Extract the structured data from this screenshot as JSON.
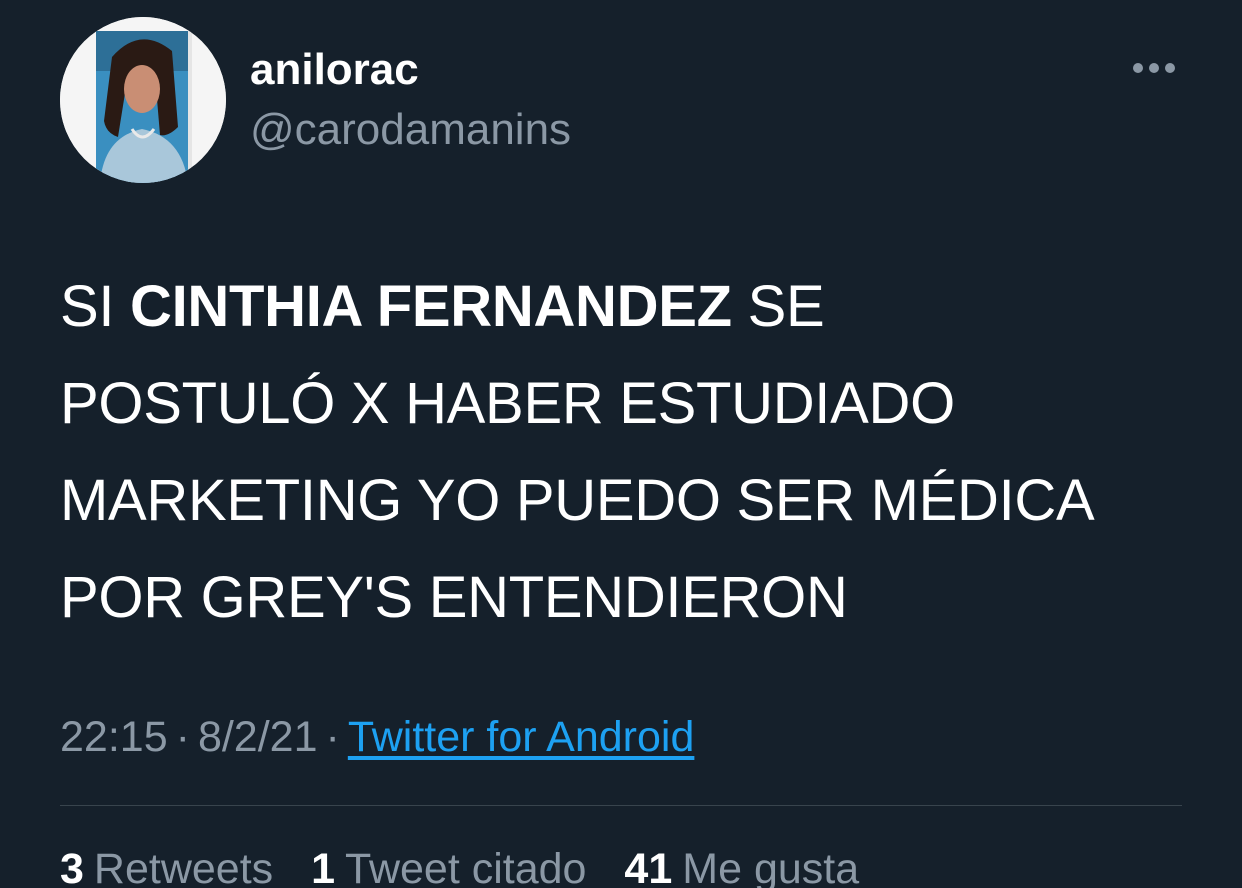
{
  "theme": {
    "background": "#15202b",
    "text_primary": "#ffffff",
    "text_secondary": "#8b98a5",
    "link": "#1da1f2",
    "divider": "#38444d"
  },
  "author": {
    "display_name": "anilorac",
    "handle": "@carodamanins",
    "avatar_icon": "user-avatar-photo"
  },
  "more_icon": "more-options-icon",
  "tweet": {
    "text_lines": [
      {
        "plain_before": "SI ",
        "bold": "CINTHIA FERNANDEZ",
        "plain_after": " SE"
      },
      {
        "plain_before": "POSTULÓ X HABER ESTUDIADO",
        "bold": "",
        "plain_after": ""
      },
      {
        "plain_before": "MARKETING YO PUEDO SER MÉDICA",
        "bold": "",
        "plain_after": ""
      },
      {
        "plain_before": "POR GREY'S ENTENDIERON",
        "bold": "",
        "plain_after": ""
      }
    ]
  },
  "meta": {
    "time": "22:15",
    "separator": "·",
    "date": "8/2/21",
    "source": "Twitter for Android"
  },
  "stats": {
    "retweets": {
      "count": "3",
      "label": "Retweets"
    },
    "quotes": {
      "count": "1",
      "label": "Tweet citado"
    },
    "likes": {
      "count": "41",
      "label": "Me gusta"
    }
  }
}
